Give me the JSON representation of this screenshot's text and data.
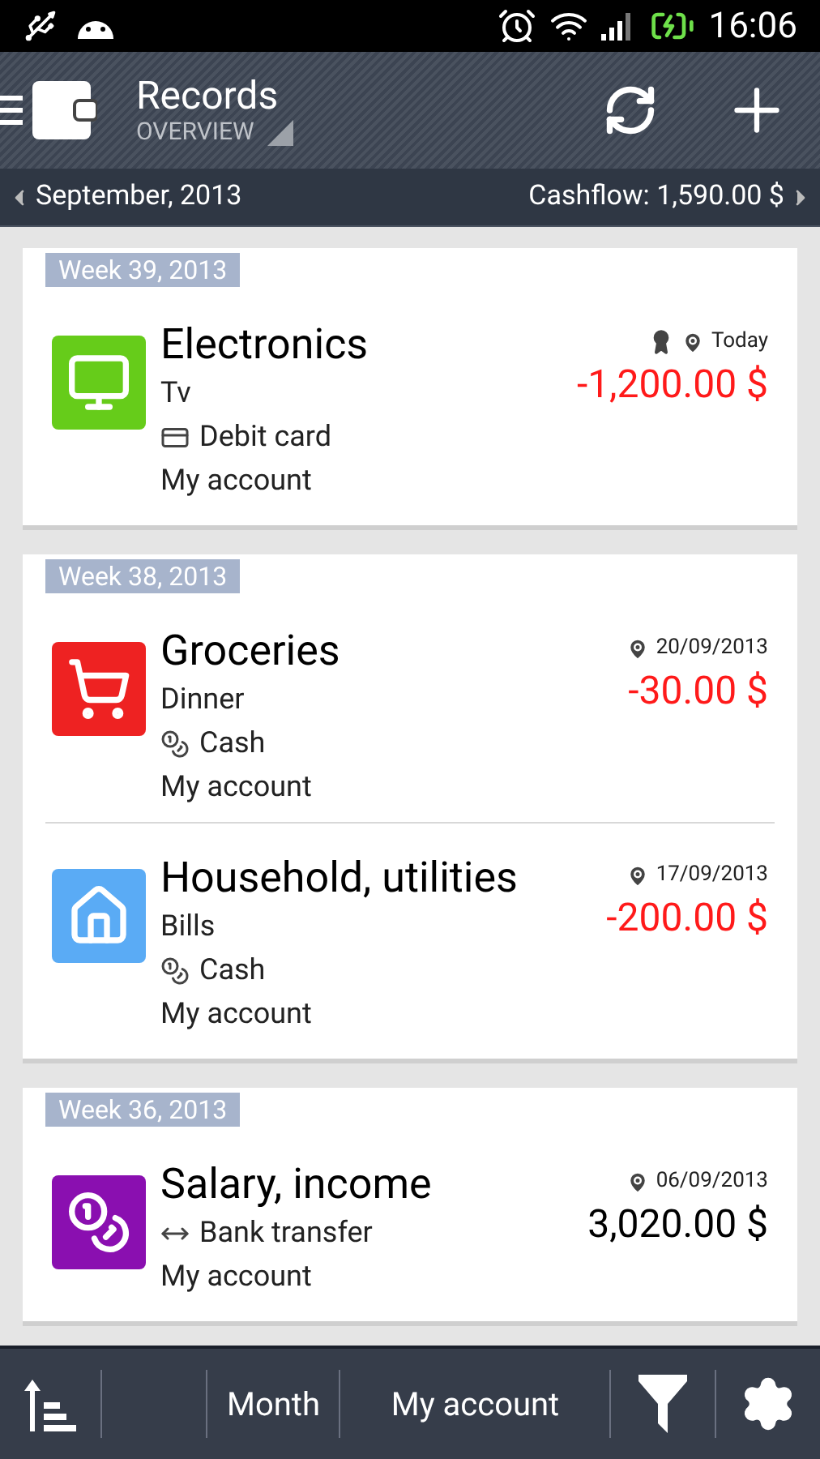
{
  "status_bar": {
    "time": "16:06"
  },
  "action_bar": {
    "title": "Records",
    "subtitle": "OVERVIEW"
  },
  "period_bar": {
    "period": "September, 2013",
    "cashflow": "Cashflow: 1,590.00 $"
  },
  "weeks": [
    {
      "label": "Week 39, 2013",
      "records": [
        {
          "category": "Electronics",
          "kind": "monitor",
          "color": "#66cc1a",
          "note": "Tv",
          "payment": {
            "label": "Debit card",
            "kind": "card"
          },
          "account": "My account",
          "date": "Today",
          "award": true,
          "amount": "-1,200.00 $",
          "income": false
        }
      ]
    },
    {
      "label": "Week 38, 2013",
      "records": [
        {
          "category": "Groceries",
          "kind": "cart",
          "color": "#ee2222",
          "note": "Dinner",
          "payment": {
            "label": "Cash",
            "kind": "cash"
          },
          "account": "My account",
          "date": "20/09/2013",
          "award": false,
          "amount": "-30.00 $",
          "income": false
        },
        {
          "category": "Household, utilities",
          "kind": "house",
          "color": "#5aabf5",
          "note": "Bills",
          "payment": {
            "label": "Cash",
            "kind": "cash"
          },
          "account": "My account",
          "date": "17/09/2013",
          "award": false,
          "amount": "-200.00 $",
          "income": false
        }
      ]
    },
    {
      "label": "Week 36, 2013",
      "records": [
        {
          "category": "Salary, income",
          "kind": "coins",
          "color": "#8a0fb0",
          "payment": {
            "label": "Bank transfer",
            "kind": "transfer"
          },
          "account": "My account",
          "date": "06/09/2013",
          "award": false,
          "amount": "3,020.00 $",
          "income": true
        }
      ]
    }
  ],
  "bottom_bar": {
    "period": "Month",
    "account": "My account"
  }
}
